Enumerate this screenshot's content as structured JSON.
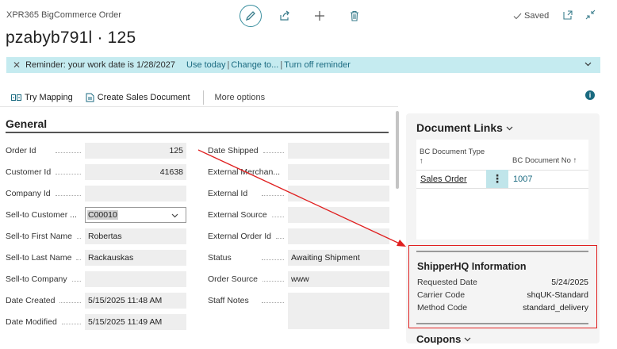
{
  "header": {
    "app_title": "XPR365 BigCommerce Order",
    "record_title": "pzabyb791l · 125",
    "saved_label": "Saved"
  },
  "reminder": {
    "text": "Reminder: your work date is 1/28/2027",
    "use_today": "Use today",
    "change_to": "Change to...",
    "turn_off": "Turn off reminder",
    "sep": "|"
  },
  "actions": {
    "try_mapping": "Try Mapping",
    "create_sales_document": "Create Sales Document",
    "more_options": "More options"
  },
  "general": {
    "title": "General",
    "left_fields": [
      {
        "label": "Order Id",
        "value": "125",
        "align": "right"
      },
      {
        "label": "Customer Id",
        "value": "41638",
        "align": "right"
      },
      {
        "label": "Company Id",
        "value": ""
      },
      {
        "label": "Sell-to Customer ...",
        "value": "C00010",
        "type": "select"
      },
      {
        "label": "Sell-to First Name",
        "value": "Robertas"
      },
      {
        "label": "Sell-to Last Name",
        "value": "Rackauskas"
      },
      {
        "label": "Sell-to Company",
        "value": ""
      },
      {
        "label": "Date Created",
        "value": "5/15/2025 11:48 AM"
      },
      {
        "label": "Date Modified",
        "value": "5/15/2025 11:49 AM"
      }
    ],
    "right_fields": [
      {
        "label": "Date Shipped",
        "value": ""
      },
      {
        "label": "External Merchan...",
        "value": ""
      },
      {
        "label": "External Id",
        "value": ""
      },
      {
        "label": "External Source",
        "value": ""
      },
      {
        "label": "External Order Id",
        "value": ""
      },
      {
        "label": "Status",
        "value": "Awaiting Shipment"
      },
      {
        "label": "Order Source",
        "value": "www"
      },
      {
        "label": "Staff Notes",
        "value": "",
        "type": "multiline"
      }
    ]
  },
  "document_links": {
    "title": "Document Links",
    "col_type": "BC Document Type",
    "col_no": "BC Document No",
    "sort_glyph": "↑",
    "rows": [
      {
        "type": "Sales Order",
        "no": "1007"
      }
    ]
  },
  "shipperhq": {
    "title": "ShipperHQ Information",
    "rows": [
      {
        "label": "Requested Date",
        "value": "5/24/2025"
      },
      {
        "label": "Carrier Code",
        "value": "shqUK-Standard"
      },
      {
        "label": "Method Code",
        "value": "standard_delivery"
      }
    ]
  },
  "coupons": {
    "title": "Coupons"
  },
  "colors": {
    "accent": "#1a6a80",
    "reminder_bg": "#c5ebf0",
    "highlight_border": "#e02020"
  }
}
